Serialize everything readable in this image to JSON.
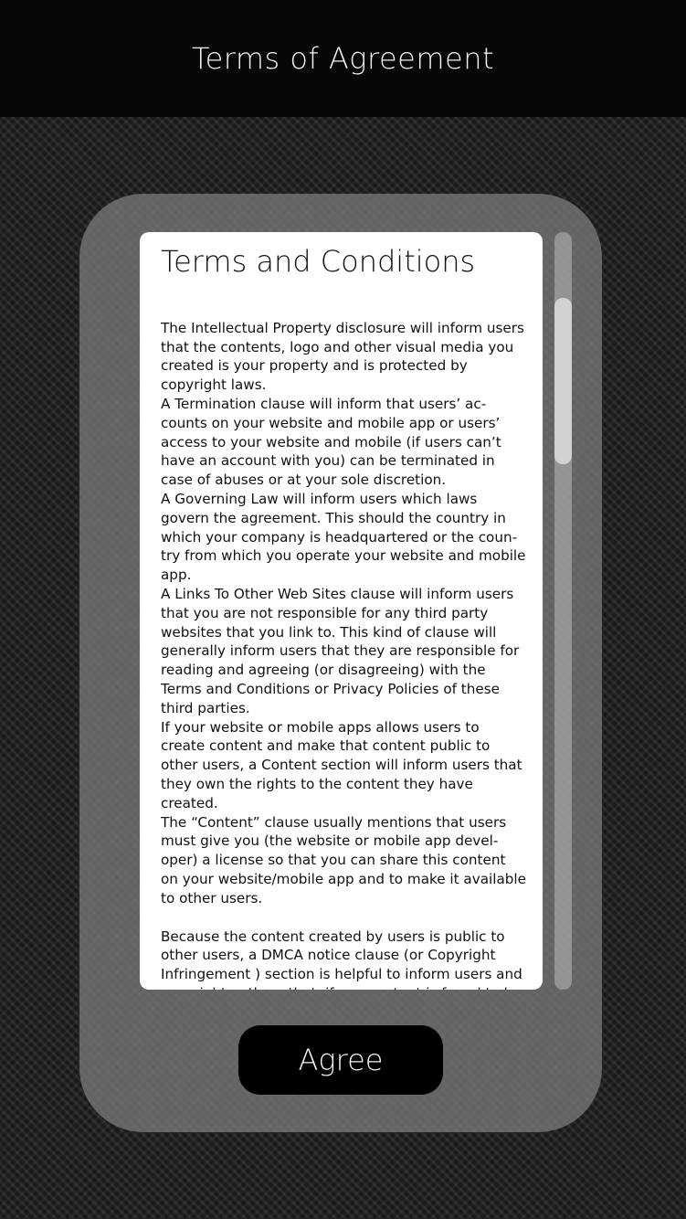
{
  "header": {
    "title": "Terms of Agreement"
  },
  "terms": {
    "title": "Terms and Conditions",
    "paragraphs": [
      "The Intellectual Property disclosure will inform users that the contents, logo and other visual media you created is your property and is protected by copyright laws.",
      "A Termination clause will inform that users’ ac­counts on your website and mobile app or users’ access to your website and mobile (if users can’t have an account with you) can be terminated in case of abuses or at your sole discretion.",
      "A Governing Law will inform users which laws govern the agreement. This should the country in which your company is headquartered or the coun­try from which you operate your website and mobile app.",
      "A Links To Other Web Sites clause will inform users that you are not responsible for any third party websites that you link to. This kind of clause will generally inform users that they are responsible for reading and agreeing (or disagreeing) with the Terms and Conditions or Privacy Policies of these third parties.",
      "If your website or mobile apps allows users to create content and make that content public to other users, a Content section will inform users that they own the rights to the content they have created.",
      "The “Content” clause usually mentions that users must give you (the website or mobile app devel­oper) a license so that you can share this content on your website/mobile app and to make it avail­able to other users.",
      "Because the content created by users is public to other users, a DMCA notice clause (or Copy­right Infringement ) section is helpful to inform users and copyright authors that, if any content is found to be a copyright infringement, you will respond to any DMCA takedown notices received and you will take down the content."
    ]
  },
  "actions": {
    "agree_label": "Agree"
  },
  "colors": {
    "header_bg": "#060707",
    "card_bg": "#ffffff",
    "button_bg": "#000000"
  }
}
